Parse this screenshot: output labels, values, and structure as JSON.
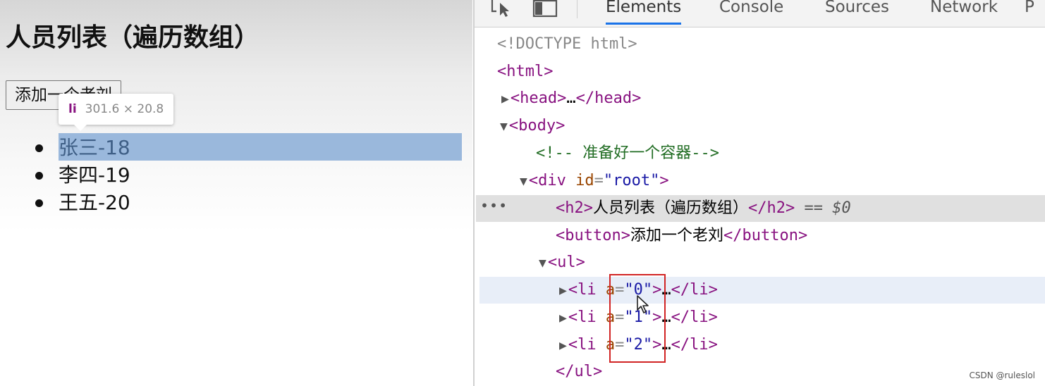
{
  "page": {
    "heading": "人员列表（遍历数组）",
    "add_button": "添加一个老刘",
    "persons": [
      "张三-18",
      "李四-19",
      "王五-20"
    ],
    "tooltip": {
      "tag": "li",
      "dims": "301.6 × 20.8"
    }
  },
  "devtools": {
    "tabs": [
      "Elements",
      "Console",
      "Sources",
      "Network",
      "P"
    ],
    "active_tab": "Elements",
    "doctype": "<!DOCTYPE html>",
    "html_open": "html",
    "head_tag": "head",
    "head_ellipsis": "…",
    "body_tag": "body",
    "comment": "<!-- 准备好一个容器-->",
    "div_tag": "div",
    "div_attr_name": "id",
    "div_attr_value": "\"root\"",
    "h2_tag": "h2",
    "h2_text": "人员列表（遍历数组）",
    "h2_suffix": "== $0",
    "button_tag": "button",
    "button_text": "添加一个老刘",
    "ul_tag": "ul",
    "li_tag": "li",
    "li_attr_name": "a",
    "li_attr_values": [
      "\"0\"",
      "\"1\"",
      "\"2\""
    ],
    "ellipsis": "…"
  },
  "watermark": "CSDN @ruleslol",
  "colors": {
    "tag": "#881280",
    "attr_name": "#994500",
    "attr_value": "#1a1aa6",
    "comment": "#236e25",
    "highlight": "#9ab8dc",
    "active_tab_underline": "#1a73e8",
    "annotation_box": "#d12424"
  }
}
